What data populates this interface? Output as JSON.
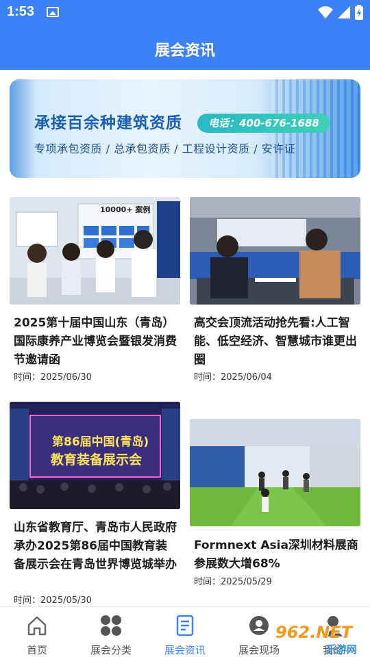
{
  "status_bar": {
    "time": "1:53"
  },
  "header": {
    "title": "展会资讯"
  },
  "banner": {
    "headline": "承接百余种建筑资质",
    "phone": "电话：400-676-1688",
    "subline": "专项承包资质 / 总承包资质 / 工程设计资质 / 安许证"
  },
  "articles": [
    {
      "title": "2025第十届中国山东（青岛）国际康养产业博览会暨银发消费节邀请函",
      "date": "时间：2025/06/30"
    },
    {
      "title": "高交会顶流活动抢先看:人工智能、低空经济、智慧城市谁更出圈",
      "date": "时间：2025/06/04"
    },
    {
      "title": "山东省教育厅、青岛市人民政府承办2025第86届中国教育装备展示会在青岛世界博览城举办",
      "date": "时间：2025/05/30"
    },
    {
      "title": "Formnext Asia深圳材料展商参展数大增68%",
      "date": "时间：2025/05/29"
    }
  ],
  "image_text": {
    "img1_sign": "10000+ 案例",
    "img3_sign_line1": "第86届中国(青岛)",
    "img3_sign_line2": "教育装备展示会"
  },
  "bottom_nav": [
    {
      "label": "首页",
      "icon": "home-icon"
    },
    {
      "label": "展会分类",
      "icon": "grid-icon"
    },
    {
      "label": "展会资讯",
      "icon": "document-icon"
    },
    {
      "label": "展会现场",
      "icon": "camera-icon"
    },
    {
      "label": "我的",
      "icon": "user-icon"
    }
  ],
  "watermark": {
    "text": "962.NET",
    "sub": "乐游网"
  },
  "colors": {
    "primary": "#3c82f6",
    "text": "#1d1d1d",
    "nav_inactive": "#555555"
  }
}
